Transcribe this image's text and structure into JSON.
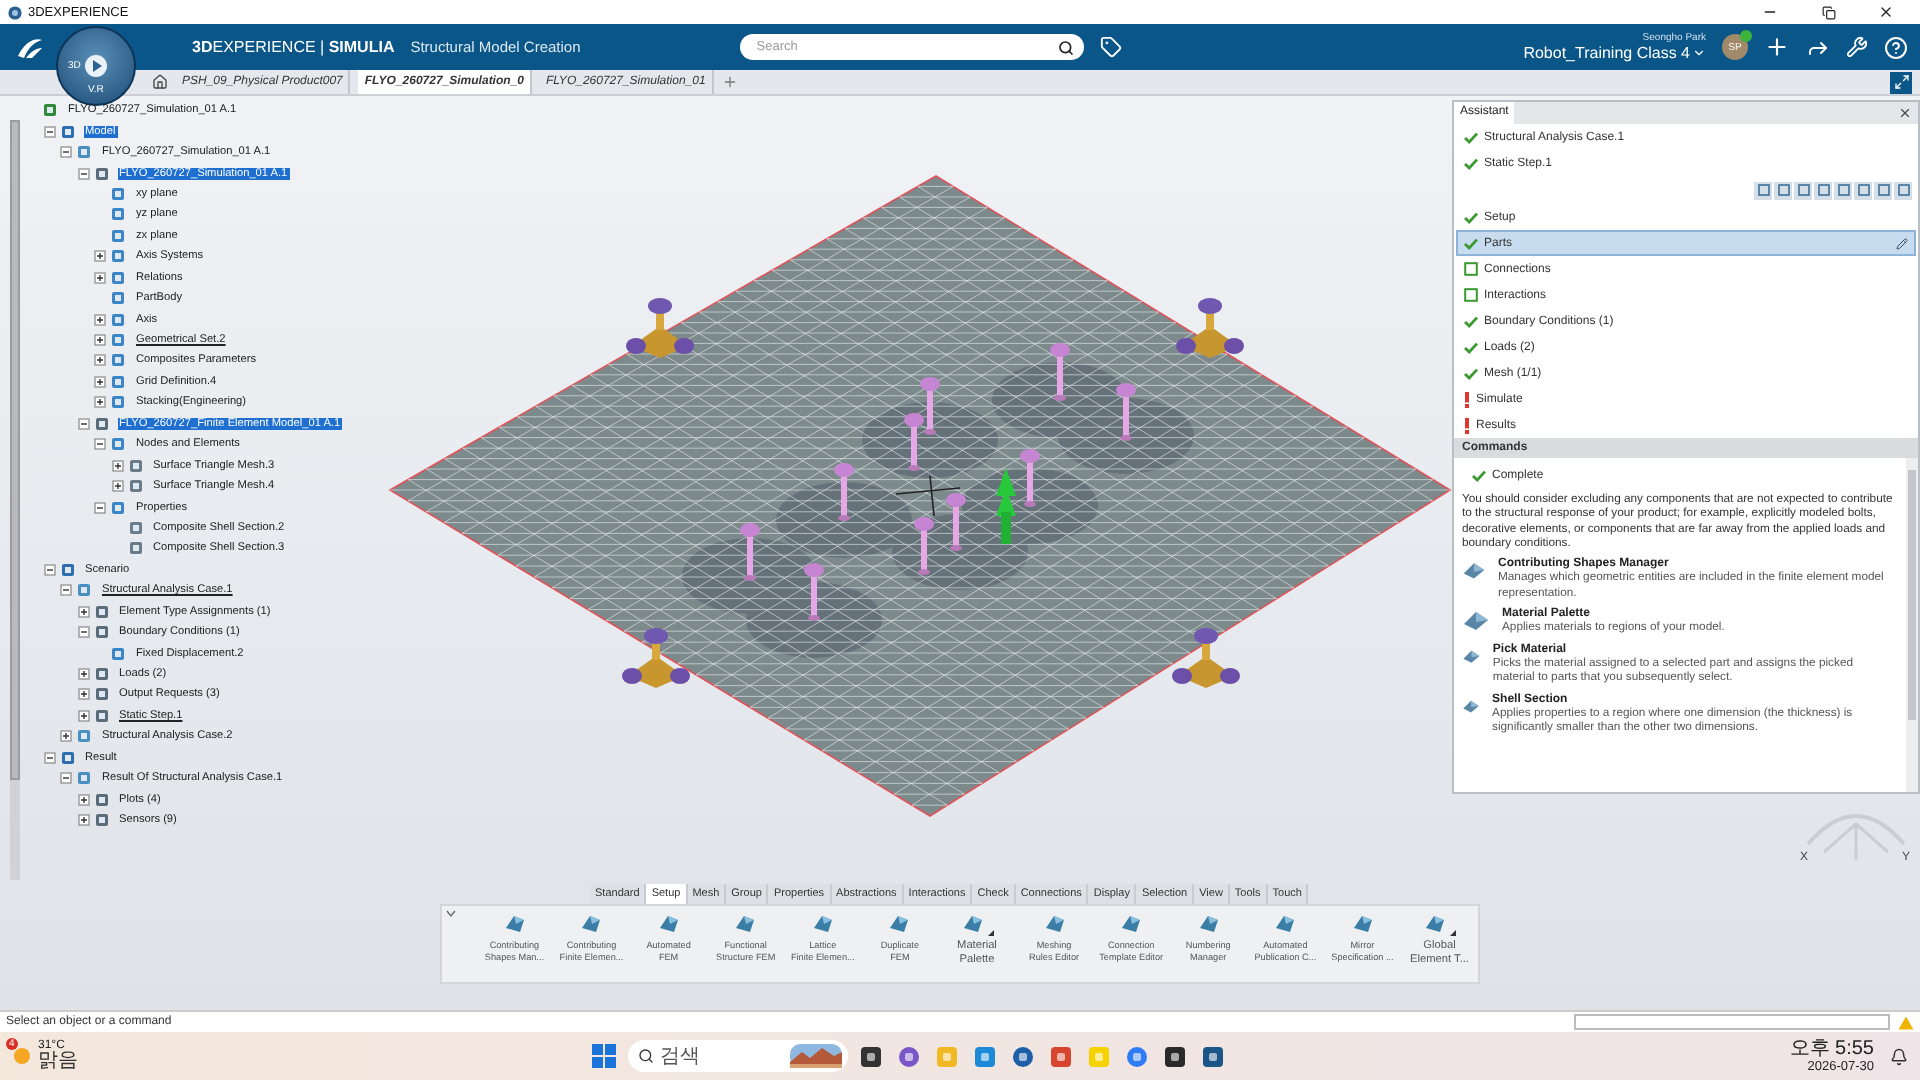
{
  "os_window": {
    "title": "3DEXPERIENCE"
  },
  "header": {
    "brand": "**3D**EXPERIENCE | **SIMULIA**",
    "app_title": "Structural Model Creation",
    "compass_labels": [
      "3D",
      "V.R"
    ],
    "search": {
      "placeholder": "Search"
    },
    "user_name": "Seongho Park",
    "collab_space": "Robot_Training Class 4",
    "avatar": "SP"
  },
  "doc_tabs": [
    {
      "label": "PSH_09_Physical Product007",
      "selected": false
    },
    {
      "label": "FLYO_260727_Simulation_0",
      "selected": true
    },
    {
      "label": "FLYO_260727_Simulation_01",
      "selected": false
    }
  ],
  "tree": {
    "items": [
      {
        "label": "FLYO_260727_Simulation_01 A.1",
        "selected": false,
        "underlined": false,
        "children": [
          {
            "label": "Model",
            "selected": true,
            "underlined": false,
            "expanded": true,
            "children": [
              {
                "label": "FLYO_260727_Simulation_01 A.1",
                "selected": false,
                "underlined": false,
                "expanded": true,
                "children": [
                  {
                    "label": "FLYO_260727_Simulation_01 A.1",
                    "selected": true,
                    "underlined": false,
                    "expanded": true,
                    "children": [
                      {
                        "label": "xy plane",
                        "selected": false,
                        "underlined": false
                      },
                      {
                        "label": "yz plane",
                        "selected": false,
                        "underlined": false
                      },
                      {
                        "label": "zx plane",
                        "selected": false,
                        "underlined": false
                      },
                      {
                        "label": "Axis Systems",
                        "selected": false,
                        "underlined": false,
                        "expanded": false
                      },
                      {
                        "label": "Relations",
                        "selected": false,
                        "underlined": false,
                        "expanded": false
                      },
                      {
                        "label": "PartBody",
                        "selected": false,
                        "underlined": false
                      },
                      {
                        "label": "Axis",
                        "selected": false,
                        "underlined": false,
                        "expanded": false
                      },
                      {
                        "label": "Geometrical Set.2",
                        "selected": false,
                        "underlined": true,
                        "expanded": false
                      },
                      {
                        "label": "Composites Parameters",
                        "selected": false,
                        "underlined": false,
                        "expanded": false
                      },
                      {
                        "label": "Grid Definition.4",
                        "selected": false,
                        "underlined": false,
                        "expanded": false
                      },
                      {
                        "label": "Stacking(Engineering)",
                        "selected": false,
                        "underlined": false,
                        "expanded": false
                      }
                    ]
                  },
                  {
                    "label": "FLYO_260727_Finite Element Model_01 A.1",
                    "selected": true,
                    "underlined": false,
                    "expanded": true,
                    "children": [
                      {
                        "label": "Nodes and Elements",
                        "selected": false,
                        "underlined": false,
                        "expanded": true,
                        "children": [
                          {
                            "label": "Surface Triangle Mesh.3",
                            "selected": false,
                            "underlined": false,
                            "expanded": false
                          },
                          {
                            "label": "Surface Triangle Mesh.4",
                            "selected": false,
                            "underlined": false,
                            "expanded": false
                          }
                        ]
                      },
                      {
                        "label": "Properties",
                        "selected": false,
                        "underlined": false,
                        "expanded": true,
                        "children": [
                          {
                            "label": "Composite Shell Section.2",
                            "selected": false,
                            "underlined": false
                          },
                          {
                            "label": "Composite Shell Section.3",
                            "selected": false,
                            "underlined": false
                          }
                        ]
                      }
                    ]
                  }
                ]
              }
            ]
          },
          {
            "label": "Scenario",
            "selected": false,
            "underlined": false,
            "expanded": true,
            "children": [
              {
                "label": "Structural Analysis Case.1",
                "selected": false,
                "underlined": true,
                "expanded": true,
                "children": [
                  {
                    "label": "Element Type Assignments (1)",
                    "selected": false,
                    "underlined": false,
                    "expanded": false
                  },
                  {
                    "label": "Boundary Conditions (1)",
                    "selected": false,
                    "underlined": false,
                    "expanded": true,
                    "children": [
                      {
                        "label": "Fixed Displacement.2",
                        "selected": false,
                        "underlined": false
                      }
                    ]
                  },
                  {
                    "label": "Loads (2)",
                    "selected": false,
                    "underlined": false,
                    "expanded": false
                  },
                  {
                    "label": "Output Requests (3)",
                    "selected": false,
                    "underlined": false,
                    "expanded": false
                  },
                  {
                    "label": "Static Step.1",
                    "selected": false,
                    "underlined": true,
                    "expanded": false
                  }
                ]
              },
              {
                "label": "Structural Analysis Case.2",
                "selected": false,
                "underlined": false,
                "expanded": false
              }
            ]
          },
          {
            "label": "Result",
            "selected": false,
            "underlined": false,
            "expanded": true,
            "children": [
              {
                "label": "Result Of Structural Analysis Case.1",
                "selected": false,
                "underlined": false,
                "expanded": true,
                "children": [
                  {
                    "label": "Plots (4)",
                    "selected": false,
                    "underlined": false,
                    "expanded": false
                  },
                  {
                    "label": "Sensors (9)",
                    "selected": false,
                    "underlined": false,
                    "expanded": false
                  }
                ]
              }
            ]
          }
        ]
      }
    ]
  },
  "assistant": {
    "title": "Assistant",
    "context": [
      {
        "label": "Structural Analysis Case.1",
        "kind": "done"
      },
      {
        "label": "Static Step.1",
        "kind": "done"
      }
    ],
    "steps": [
      {
        "label": "Setup",
        "kind": "done",
        "selected": false
      },
      {
        "label": "Parts",
        "kind": "done",
        "selected": true
      },
      {
        "label": "Connections",
        "kind": "todo",
        "selected": false
      },
      {
        "label": "Interactions",
        "kind": "todo",
        "selected": false
      },
      {
        "label": "Boundary Conditions (1)",
        "kind": "done",
        "selected": false
      },
      {
        "label": "Loads (2)",
        "kind": "done",
        "selected": false
      },
      {
        "label": "Mesh (1/1)",
        "kind": "done",
        "selected": false
      },
      {
        "label": "Simulate",
        "kind": "error",
        "selected": false
      },
      {
        "label": "Results",
        "kind": "error",
        "selected": false
      }
    ],
    "commands_title": "Commands",
    "complete": "Complete",
    "advice": "You should consider excluding any components that are not expected to contribute to the structural response of your product; for example, explicitly modeled bolts, decorative elements, or components that are far away from the applied loads and boundary conditions.",
    "commands": [
      {
        "title": "Contributing Shapes Manager",
        "description": "Manages which geometric entities are included in the finite element model representation."
      },
      {
        "title": "Material Palette",
        "description": "Applies materials to regions of your model."
      },
      {
        "title": "Pick Material",
        "description": "Picks the material assigned to a selected part and assigns the picked material to parts that you subsequently select."
      },
      {
        "title": "Shell Section",
        "description": "Applies properties to a region where one dimension (the thickness) is significantly smaller than the other two dimensions."
      }
    ]
  },
  "toolbar": {
    "tabs": [
      {
        "label": "Standard",
        "selected": false
      },
      {
        "label": "Setup",
        "selected": true
      },
      {
        "label": "Mesh",
        "selected": false
      },
      {
        "label": "Group",
        "selected": false
      },
      {
        "label": "Properties",
        "selected": false
      },
      {
        "label": "Abstractions",
        "selected": false
      },
      {
        "label": "Interactions",
        "selected": false
      },
      {
        "label": "Check",
        "selected": false
      },
      {
        "label": "Connections",
        "selected": false
      },
      {
        "label": "Display",
        "selected": false
      },
      {
        "label": "Selection",
        "selected": false
      },
      {
        "label": "View",
        "selected": false
      },
      {
        "label": "Tools",
        "selected": false
      },
      {
        "label": "Touch",
        "selected": false
      }
    ],
    "commands": [
      {
        "label": "Contributing\nShapes Man...",
        "has_menu": false
      },
      {
        "label": "Contributing\nFinite Elemen...",
        "has_menu": false
      },
      {
        "label": "Automated\nFEM",
        "has_menu": false
      },
      {
        "label": "Functional\nStructure FEM",
        "has_menu": false
      },
      {
        "label": "Lattice\nFinite Elemen...",
        "has_menu": false
      },
      {
        "label": "Duplicate\nFEM",
        "has_menu": false
      },
      {
        "label": "Material\nPalette",
        "has_menu": true
      },
      {
        "label": "Meshing\nRules Editor",
        "has_menu": false
      },
      {
        "label": "Connection\nTemplate Editor",
        "has_menu": false
      },
      {
        "label": "Numbering\nManager",
        "has_menu": false
      },
      {
        "label": "Automated\nPublication C...",
        "has_menu": false
      },
      {
        "label": "Mirror\nSpecification ...",
        "has_menu": false
      },
      {
        "label": "Global\nElement T...",
        "has_menu": true
      }
    ]
  },
  "compass": {
    "x_label": "X",
    "y_label": "Y"
  },
  "status_bar": {
    "prompt": "Select an object or a command"
  },
  "taskbar": {
    "notification_count": "4",
    "temperature": "31°C",
    "condition": "맑음",
    "search_placeholder": "검색",
    "time": "오후 5:55",
    "date": "2026-07-30"
  }
}
